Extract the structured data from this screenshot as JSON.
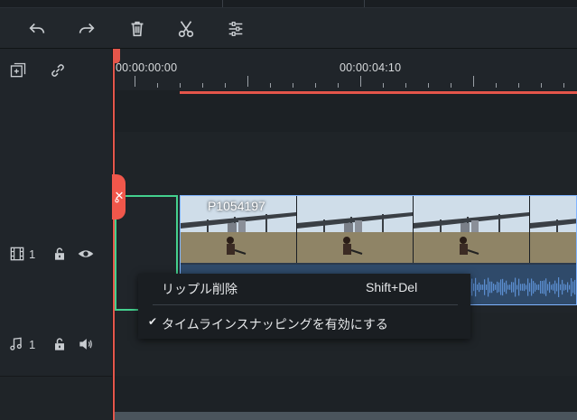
{
  "toolbar": {
    "buttons": [
      {
        "name": "undo-icon"
      },
      {
        "name": "redo-icon"
      },
      {
        "name": "delete-icon"
      },
      {
        "name": "cut-icon"
      },
      {
        "name": "adjust-icon"
      }
    ]
  },
  "track_header": {
    "add_track_icon": "add-track-icon",
    "link_icon": "link-icon",
    "video_track": {
      "number": "1"
    },
    "audio_track": {
      "number": "1"
    }
  },
  "ruler": {
    "start_timecode": "00:00:00:00",
    "mid_timecode": "00:00:04:10"
  },
  "clip": {
    "name": "P1054197"
  },
  "context_menu": {
    "items": [
      {
        "label": "リップル削除",
        "shortcut": "Shift+Del",
        "checked": false
      },
      {
        "label": "タイムラインスナッピングを有効にする",
        "shortcut": "",
        "checked": true
      }
    ],
    "check_mark": "✔"
  },
  "colors": {
    "accent": "#e4554a",
    "selection": "#44d08e",
    "clip_border": "#7fb4ff",
    "audio_wave": "#5b8ed1"
  }
}
